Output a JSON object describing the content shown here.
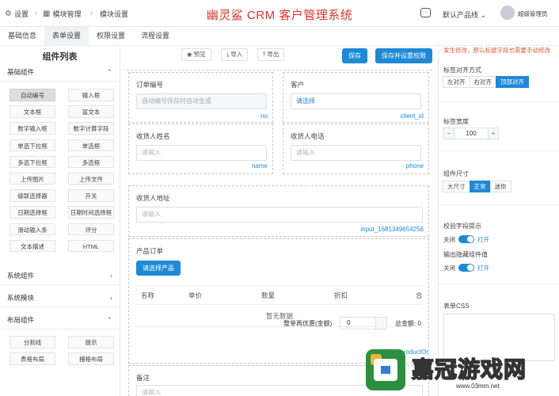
{
  "topbar": {
    "settings": "设置",
    "module_mgmt": "模块管理",
    "module_settings": "模块设置",
    "title": "幽灵鲨 CRM 客户管理系统",
    "product": "默认产品线",
    "user": "超级管理员"
  },
  "tabs": [
    "基础信息",
    "表单设置",
    "权限设置",
    "流程设置"
  ],
  "left": {
    "title": "组件列表",
    "basic": "基础组件",
    "basic_items": [
      "自动编号",
      "输入框",
      "文本框",
      "富文本",
      "数字输入框",
      "数字计算字段",
      "单选下拉框",
      "单选框",
      "多选下拉框",
      "多选框",
      "上传图片",
      "上传文件",
      "级联选择器",
      "开关",
      "日期选择框",
      "日期时间选择框",
      "滑动输入条",
      "评分",
      "文本描述",
      "HTML"
    ],
    "system_comp": "系统组件",
    "system_module": "系统模块",
    "layout": "布局组件",
    "layout_items": [
      "分割线",
      "提示",
      "表格布局",
      "栅格布局"
    ]
  },
  "toolbar": {
    "preview": "预览",
    "import": "导入",
    "export": "导出",
    "save": "保存",
    "save_perm": "保存并设置权限"
  },
  "form": {
    "order_no": {
      "label": "订单编号",
      "placeholder": "自动编号保存时自动生成",
      "key": "no"
    },
    "customer": {
      "label": "客户",
      "value": "请选择",
      "key": "client_id"
    },
    "recv_name": {
      "label": "收货人姓名",
      "placeholder": "请输入",
      "key": "name"
    },
    "recv_phone": {
      "label": "收货人电话",
      "placeholder": "请输入",
      "key": "phone"
    },
    "recv_addr": {
      "label": "收货人地址",
      "placeholder": "请输入",
      "key": "input_1681349654256"
    },
    "product_order": {
      "label": "产品订单",
      "add_btn": "请选择产品",
      "columns": [
        "名称",
        "单价",
        "数量",
        "折扣",
        "合"
      ],
      "empty": "暂无数据",
      "discount_label": "整单再优惠(金额)",
      "discount_value": "0",
      "total_label": "总金额: 0",
      "key": "productOr"
    },
    "remark": {
      "label": "备注",
      "placeholder": "请输入"
    }
  },
  "right": {
    "note": "发生修改，那么标题字段也需要手动修改",
    "label_align": "标签对齐方式",
    "align_opts": [
      "左对齐",
      "右对齐",
      "顶部对齐"
    ],
    "label_width": "标签宽度",
    "label_width_value": "100",
    "comp_size": "组件尺寸",
    "size_opts": [
      "大尺寸",
      "正常",
      "迷你"
    ],
    "validate": "校验字段提示",
    "output_hidden": "输出隐藏组件值",
    "off": "关闭",
    "on": "打开",
    "form_css": "表单CSS"
  },
  "watermark": {
    "text": "嘉冠游戏网",
    "url": "www.03mm.net"
  }
}
